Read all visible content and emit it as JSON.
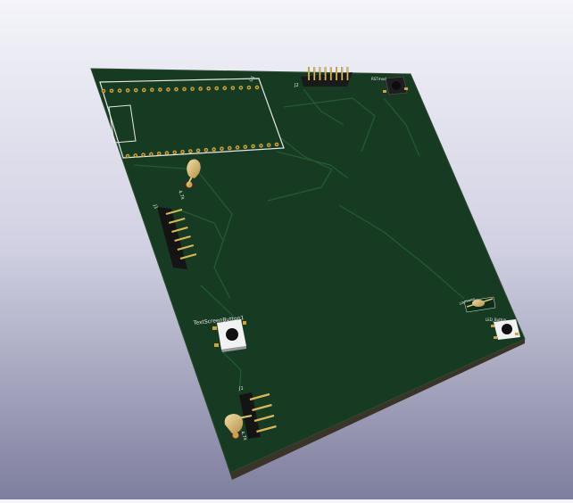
{
  "viewer": {
    "background_top": "#f4f4fa",
    "background_bottom": "#7e7e9e"
  },
  "board": {
    "soldermask_color": "#173a22",
    "edge_color": "#3a3428",
    "silkscreen_color": "#e8e8e8",
    "pad_color": "#c9a441",
    "trace_color": "#235a34"
  },
  "labels": {
    "u1": "U1",
    "r1": "R1",
    "j2": "J2",
    "j3": "J3",
    "j1": "J1",
    "resistor_top": "4.7k",
    "resistor_bottom": "4.7k",
    "text_screen_button": "TextScreenButton1",
    "sw_top_right": "RSTmod",
    "thermistor": "10kTHerm",
    "sw_right": "LED_Button"
  }
}
